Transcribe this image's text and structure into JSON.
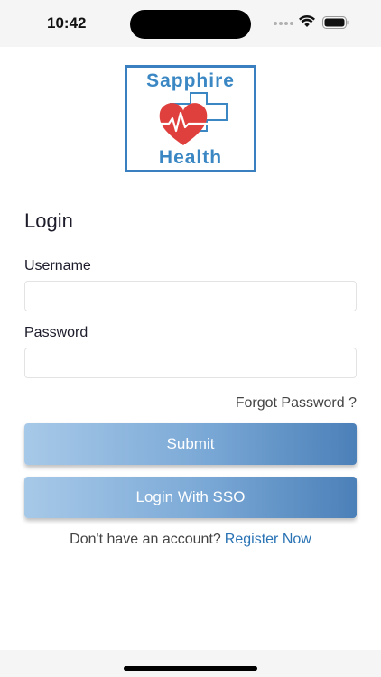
{
  "status_bar": {
    "time": "10:42"
  },
  "logo": {
    "top_text": "Sapphire",
    "bottom_text": "Health",
    "colors": {
      "brand_blue": "#3a87c4",
      "heart_red": "#e0403d"
    }
  },
  "form": {
    "heading": "Login",
    "username_label": "Username",
    "username_value": "",
    "username_placeholder": "",
    "password_label": "Password",
    "password_value": "",
    "password_placeholder": "",
    "forgot_label": "Forgot Password ?",
    "submit_label": "Submit",
    "sso_label": "Login With SSO",
    "register_prompt": "Don't have an account?",
    "register_link": "Register Now"
  },
  "icons": {
    "cellular": "cellular-signal-icon",
    "wifi": "wifi-icon",
    "battery": "battery-icon",
    "heart": "heart-pulse-icon",
    "cross": "medical-cross-icon"
  }
}
